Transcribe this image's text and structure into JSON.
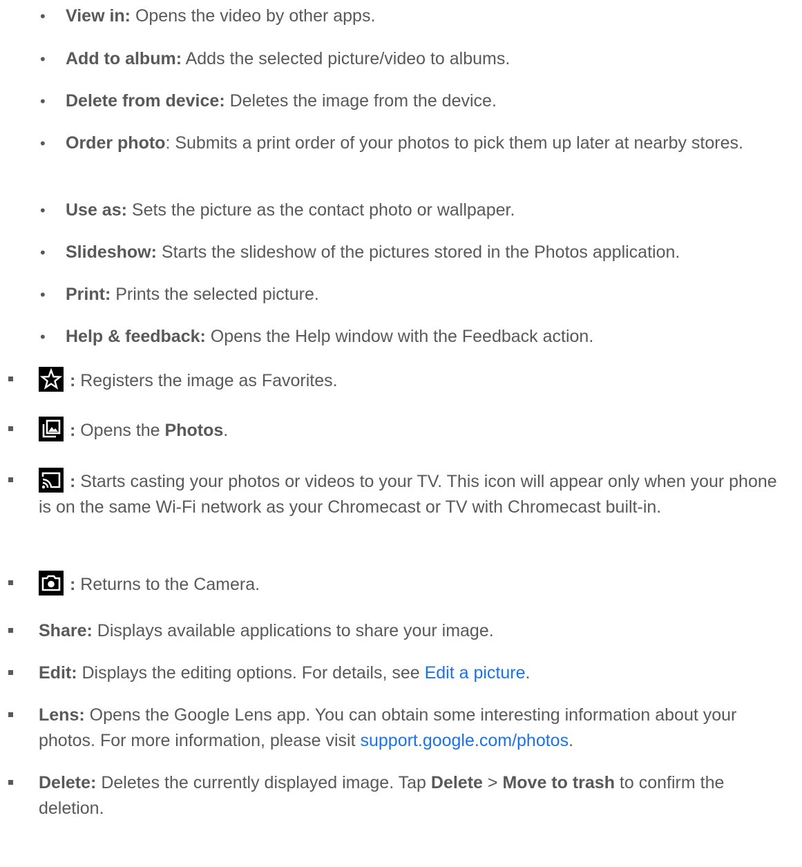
{
  "sub_items": [
    {
      "term": "View in:",
      "desc": " Opens the video by other apps."
    },
    {
      "term": "Add to album:",
      "desc": " Adds the selected picture/video to albums."
    },
    {
      "term": "Delete from device:",
      "desc": " Deletes the image from the device."
    },
    {
      "term": "Order photo",
      "desc": ": Submits a print order of your photos to pick them up later at nearby stores."
    },
    {
      "term": "Use as:",
      "desc": " Sets the picture as the contact photo or wallpaper."
    },
    {
      "term": "Slideshow:",
      "desc": " Starts the slideshow of the pictures stored in the Photos application."
    },
    {
      "term": "Print:",
      "desc": " Prints the selected picture."
    },
    {
      "term": "Help & feedback:",
      "desc": " Opens the Help window with the Feedback action."
    }
  ],
  "icon_items": {
    "favorite": {
      "icon": "star-icon",
      "colon": " :",
      "desc": " Registers the image as Favorites."
    },
    "photos": {
      "icon": "photo-library-icon",
      "colon": " :",
      "desc_before": " Opens the ",
      "bold": "Photos",
      "desc_after": "."
    },
    "cast": {
      "icon": "cast-icon",
      "colon": " :",
      "desc": " Starts casting your photos or videos to your TV. This icon will appear only when your phone is on the same Wi-Fi network as your Chromecast or TV with Chromecast built-in."
    },
    "camera": {
      "icon": "camera-icon",
      "colon": " :",
      "desc": " Returns to the Camera."
    }
  },
  "text_items": {
    "share": {
      "term": "Share:",
      "desc": " Displays available applications to share your image."
    },
    "edit": {
      "term": "Edit:",
      "desc": " Displays the editing options. For details, see ",
      "link": "Edit a picture",
      "after": "."
    },
    "lens": {
      "term": "Lens:",
      "desc": " Opens the Google Lens app. You can obtain some interesting information about your photos. For more information, please visit ",
      "link": "support.google.com/photos",
      "after": "."
    },
    "delete": {
      "term": "Delete:",
      "desc1": " Deletes the currently displayed image. Tap ",
      "bold1": "Delete",
      "sep": " > ",
      "bold2": "Move to trash",
      "desc2": " to confirm the deletion."
    }
  },
  "colors": {
    "text": "#595959",
    "link": "#1a73e8",
    "icon_bg": "#000000"
  }
}
